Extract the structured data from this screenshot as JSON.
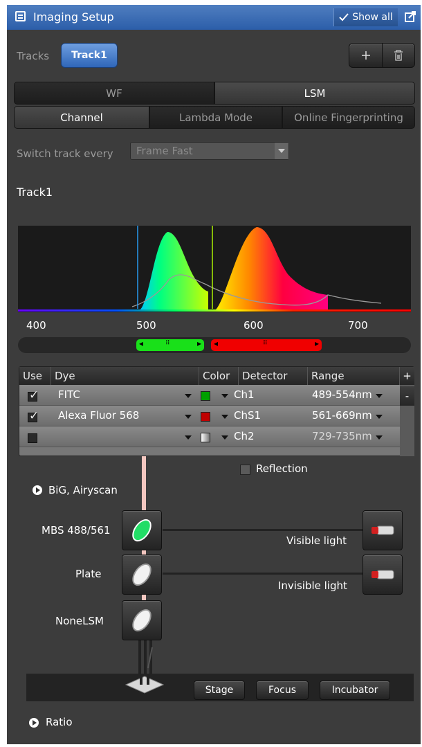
{
  "header": {
    "title": "Imaging Setup",
    "show_all": "Show all",
    "show_all_icon": "checkmark-icon",
    "undock_icon": "undock-icon"
  },
  "tracks": {
    "label": "Tracks",
    "active": "Track1",
    "add_icon": "plus-icon",
    "delete_icon": "trash-icon"
  },
  "mode_tabs": [
    {
      "label": "WF",
      "active": false
    },
    {
      "label": "LSM",
      "active": true
    }
  ],
  "sub_tabs": [
    {
      "label": "Channel",
      "active": true
    },
    {
      "label": "Lambda Mode",
      "active": false
    },
    {
      "label": "Online Fingerprinting",
      "active": false
    }
  ],
  "switch_track": {
    "label": "Switch track every",
    "value": "Frame Fast"
  },
  "section_title": "Track1",
  "spectrum": {
    "tick_labels": [
      "400",
      "500",
      "600",
      "700"
    ],
    "x_range": [
      360,
      760
    ],
    "laser_lines_nm": [
      488,
      561
    ],
    "bands": [
      {
        "from_nm": 489,
        "to_nm": 554,
        "color": "#00e000"
      },
      {
        "from_nm": 561,
        "to_nm": 669,
        "color": "#e00000"
      }
    ]
  },
  "table": {
    "headers": [
      "Use",
      "Dye",
      "Color",
      "Detector",
      "Range"
    ],
    "rows": [
      {
        "use": true,
        "dye": "FITC",
        "color": "#00a000",
        "detector": "Ch1",
        "range": "489-554nm"
      },
      {
        "use": true,
        "dye": "Alexa Fluor 568",
        "color": "#c00000",
        "detector": "ChS1",
        "range": "561-669nm"
      },
      {
        "use": false,
        "dye": "",
        "color": "#bbbbbb",
        "detector": "Ch2",
        "range": "729-735nm"
      }
    ],
    "add_label": "+",
    "remove_label": "-"
  },
  "reflection": {
    "label": "Reflection",
    "checked": false
  },
  "big_airyscan": "BiG, Airyscan",
  "lightpath": {
    "mbs": "MBS 488/561",
    "plate": "Plate",
    "none": "NoneLSM",
    "visible": "Visible light",
    "invisible": "Invisible light"
  },
  "bottom_buttons": {
    "stage": "Stage",
    "focus": "Focus",
    "incubator": "Incubator"
  },
  "ratio": "Ratio"
}
